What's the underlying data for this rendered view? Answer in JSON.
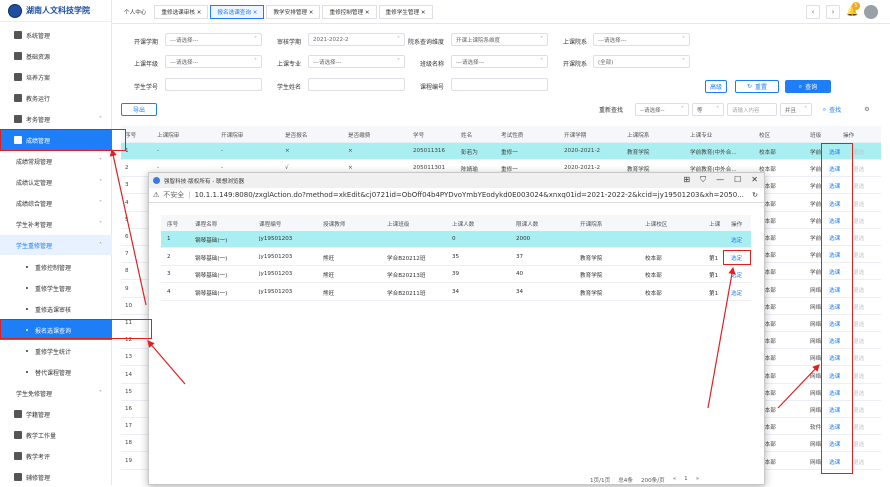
{
  "logo": {
    "text": "湖南人文科技学院"
  },
  "sidebar": {
    "items": [
      {
        "label": "系统管理",
        "icon": "grid-icon"
      },
      {
        "label": "基础资源",
        "icon": "flag-icon"
      },
      {
        "label": "培养方案",
        "icon": "book-icon"
      },
      {
        "label": "教务运行",
        "icon": "chart-icon"
      },
      {
        "label": "考务管理",
        "icon": "person-icon"
      },
      {
        "label": "成绩管理",
        "icon": "briefcase-icon"
      }
    ],
    "subitems": [
      {
        "label": "成绩常规管理"
      },
      {
        "label": "成绩认定管理"
      },
      {
        "label": "成绩综合管理"
      },
      {
        "label": "学生补考管理"
      },
      {
        "label": "学生重修管理"
      }
    ],
    "subsub": [
      {
        "label": "重修控制管理"
      },
      {
        "label": "重修学生管理"
      },
      {
        "label": "重修选课审核"
      },
      {
        "label": "报名选课查询"
      },
      {
        "label": "重修学生统计"
      },
      {
        "label": "替代课程管理"
      }
    ],
    "bottom": [
      {
        "label": "学生免修管理"
      },
      {
        "label": "学籍管理"
      },
      {
        "label": "教学工作量"
      },
      {
        "label": "教学考评"
      },
      {
        "label": "辅修管理"
      }
    ]
  },
  "tabs": [
    {
      "label": "个人中心"
    },
    {
      "label": "重修选课审核 ✕"
    },
    {
      "label": "报名选课查询 ✕"
    },
    {
      "label": "教学安排管理 ✕"
    },
    {
      "label": "重修控制管理 ✕"
    },
    {
      "label": "重修学生管理 ✕"
    }
  ],
  "notify_count": "5",
  "form": {
    "open_term": {
      "label": "开课学期",
      "value": "---请选择---"
    },
    "audit_term": {
      "label": "审核学期",
      "value": "2021-2022-2"
    },
    "dept_query": {
      "label": "院系查询维度",
      "value": "开课上课院系维度"
    },
    "class_dept": {
      "label": "上课院系",
      "value": "---请选择---"
    },
    "grade": {
      "label": "上课年级",
      "value": "---请选择---"
    },
    "major": {
      "label": "上课专业",
      "value": "---请选择---"
    },
    "class_name": {
      "label": "班级名称",
      "value": "---请选择---"
    },
    "open_dept": {
      "label": "开课院系",
      "value": "(全部)"
    },
    "student_no": {
      "label": "学生学号",
      "value": ""
    },
    "student_name": {
      "label": "学生姓名",
      "value": ""
    },
    "course_no": {
      "label": "课程编号",
      "value": ""
    },
    "collapse": "高级",
    "reset": "重置",
    "query": "查询"
  },
  "toolbar": {
    "export": "导出",
    "refind": "重新查找",
    "filter1": "--请选择--",
    "filter2": "等",
    "filter3": "请输入内容",
    "filter4": "并且",
    "search": "查找"
  },
  "grid": {
    "headers": [
      "序号",
      "上课院审",
      "开课院审",
      "是否报名",
      "是否缴费",
      "学号",
      "姓名",
      "考试性质",
      "开课学期",
      "上课院系",
      "上课专业",
      "校区",
      "班级",
      "操作"
    ],
    "rows": [
      {
        "no": "1",
        "a": "-",
        "b": "-",
        "c": "×",
        "d": "×",
        "sno": "205011316",
        "name": "彭若为",
        "type": "重修一",
        "term": "2020-2021-2",
        "dept": "教育学院",
        "major": "学前教育(中外合...",
        "campus": "校本部",
        "cls": "学前",
        "op": "选课",
        "op2": "退选"
      },
      {
        "no": "2",
        "a": "-",
        "b": "-",
        "c": "√",
        "d": "×",
        "sno": "205011301",
        "name": "陈婧瑜",
        "type": "重修一",
        "term": "2020-2021-2",
        "dept": "教育学院",
        "major": "学前教育(中外合...",
        "campus": "校本部",
        "cls": "学前",
        "op": "选课",
        "op2": "退选"
      },
      {
        "no": "3",
        "campus": "校本部",
        "cls": "学前",
        "op": "选课",
        "op2": "退选"
      },
      {
        "no": "4",
        "campus": "校本部",
        "cls": "学前",
        "op": "选课",
        "op2": "退选"
      },
      {
        "no": "5",
        "campus": "校本部",
        "cls": "学前",
        "op": "选课",
        "op2": "退选"
      },
      {
        "no": "6",
        "campus": "校本部",
        "cls": "学前",
        "op": "选课",
        "op2": "退选"
      },
      {
        "no": "7",
        "campus": "校本部",
        "cls": "学前",
        "op": "选课",
        "op2": "退选"
      },
      {
        "no": "8",
        "campus": "校本部",
        "cls": "学前",
        "op": "选课",
        "op2": "退选"
      },
      {
        "no": "9",
        "campus": "校本部",
        "cls": "网络",
        "op": "选课",
        "op2": "退选"
      },
      {
        "no": "10",
        "campus": "校本部",
        "cls": "网络",
        "op": "选课",
        "op2": "退选"
      },
      {
        "no": "11",
        "campus": "校本部",
        "cls": "网络",
        "op": "选课",
        "op2": "退选"
      },
      {
        "no": "12",
        "campus": "校本部",
        "cls": "网络",
        "op": "选课",
        "op2": "退选"
      },
      {
        "no": "13",
        "campus": "校本部",
        "cls": "网络",
        "op": "选课",
        "op2": "退选"
      },
      {
        "no": "14",
        "campus": "校本部",
        "cls": "网络",
        "op": "选课",
        "op2": "退选"
      },
      {
        "no": "15",
        "campus": "校本部",
        "cls": "网络",
        "op": "选课",
        "op2": "退选"
      },
      {
        "no": "16",
        "campus": "校本部",
        "cls": "网络",
        "op": "选课",
        "op2": "退选"
      },
      {
        "no": "17",
        "campus": "校本部",
        "cls": "软件",
        "op": "选课",
        "op2": "退选"
      },
      {
        "no": "18",
        "campus": "校本部",
        "cls": "网络",
        "op": "选课",
        "op2": "退选"
      },
      {
        "no": "19",
        "campus": "校本部",
        "cls": "网络",
        "op": "选课",
        "op2": "退选"
      }
    ]
  },
  "popup": {
    "title": "强智科技·版权所有 - 联想浏览器",
    "unsafe": "不安全",
    "url": "10.1.1.149:8080/zxglAction.do?method=xkEdit&cj0721id=ObOff04b4PYDvoYmbYEodykd0E003024&xnxq01id=2021-2022-2&kcid=jy19501203&xh=2050...",
    "headers": [
      "序号",
      "课程名称",
      "课程编号",
      "授课教师",
      "上课班级",
      "上课人数",
      "限课人数",
      "开课院系",
      "上课校区",
      "上课",
      "操作"
    ],
    "rows": [
      {
        "no": "1",
        "course": "钢琴基础(一)",
        "code": "jy19501203",
        "teacher": "",
        "cls": "",
        "n": "0",
        "limit": "2000",
        "dept": "",
        "campus": "",
        "time": "",
        "op": "选定"
      },
      {
        "no": "2",
        "course": "钢琴基础(一)",
        "code": "jy19501203",
        "teacher": "熊旺",
        "cls": "学合B20212班",
        "n": "35",
        "limit": "37",
        "dept": "教育学院",
        "campus": "校本部",
        "time": "第1",
        "op": "选定"
      },
      {
        "no": "3",
        "course": "钢琴基础(一)",
        "code": "jy19501203",
        "teacher": "熊旺",
        "cls": "学合B20213班",
        "n": "39",
        "limit": "40",
        "dept": "教育学院",
        "campus": "校本部",
        "time": "第1",
        "op": "选定"
      },
      {
        "no": "4",
        "course": "钢琴基础(一)",
        "code": "jy19501203",
        "teacher": "熊旺",
        "cls": "学合B20211班",
        "n": "34",
        "limit": "34",
        "dept": "教育学院",
        "campus": "校本部",
        "time": "第1",
        "op": "选定"
      }
    ]
  },
  "pager": {
    "info": "1页/1页",
    "total": "总4条",
    "per": "200条/页",
    "page": "1"
  }
}
